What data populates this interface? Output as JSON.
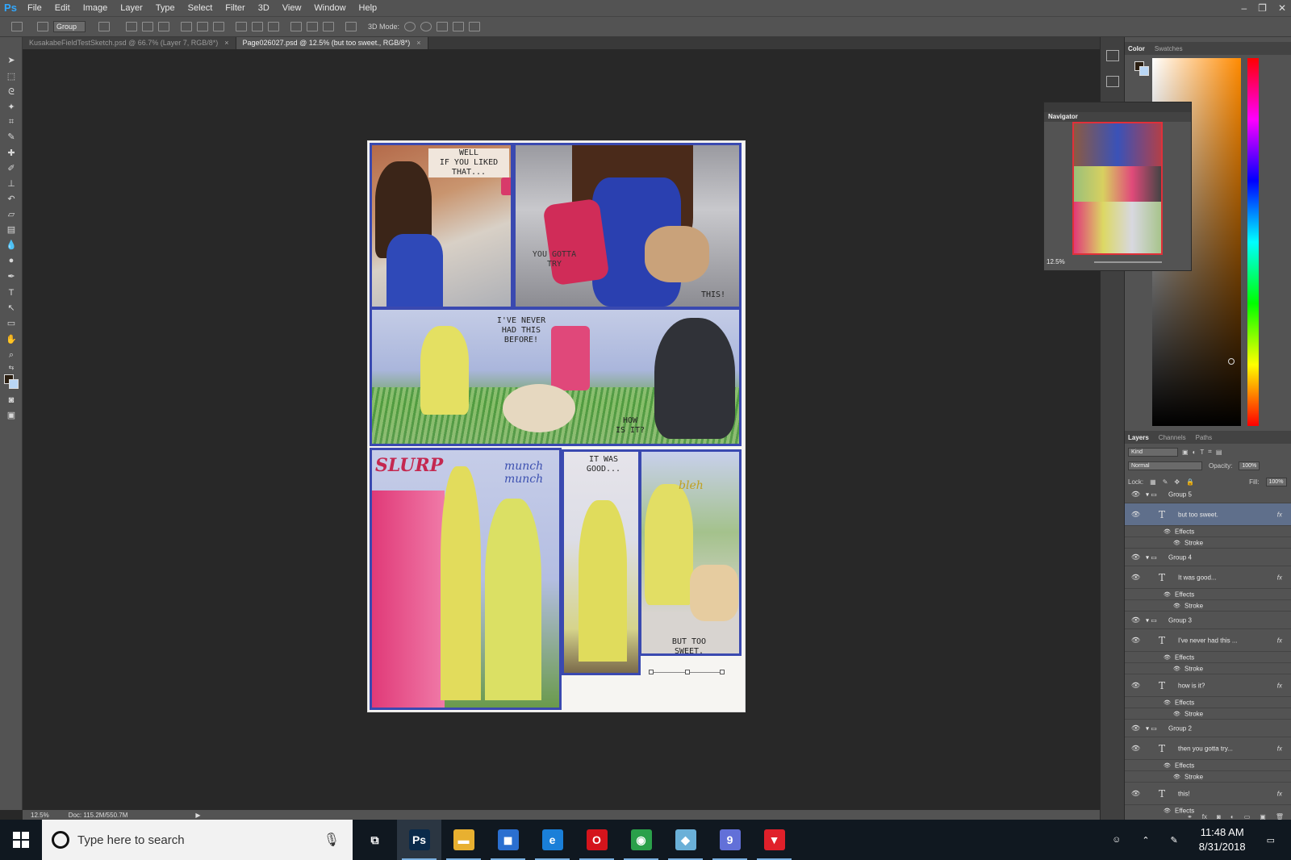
{
  "app": {
    "logo": "Ps"
  },
  "menu": [
    "File",
    "Edit",
    "Image",
    "Layer",
    "Type",
    "Select",
    "Filter",
    "3D",
    "View",
    "Window",
    "Help"
  ],
  "window_controls": {
    "minimize": "–",
    "restore": "❐",
    "close": "✕"
  },
  "options": {
    "group_select": "Group",
    "mode_label": "3D Mode:"
  },
  "tabs": [
    {
      "label": "KusakabeFieldTestSketch.psd @ 66.7% (Layer 7, RGB/8*)",
      "close": "×"
    },
    {
      "label": "Page026027.psd @ 12.5% (but too sweet., RGB/8*)",
      "close": "×"
    }
  ],
  "artwork": {
    "panel1_caption": "WELL\nIF YOU LIKED\nTHAT...",
    "panel2_caption": "YOU GOTTA\nTRY",
    "panel2_caption_b": "THIS!",
    "panel3_caption": "I'VE NEVER\nHAD THIS\nBEFORE!",
    "panel3_caption_b": "HOW\nIS IT?",
    "sfx_slurp": "SLURP",
    "sfx_munch": "munch\nmunch",
    "panel5_caption": "IT WAS\nGOOD...",
    "sfx_bleh": "bleh",
    "panel6_caption": "BUT TOO\nSWEET."
  },
  "statusbar": {
    "zoom": "12.5%",
    "doc": "Doc: 115.2M/550.7M",
    "arrow": "▶"
  },
  "navigator": {
    "title": "Navigator",
    "zoom": "12.5%"
  },
  "color_panel": {
    "tabs": [
      "Color",
      "Swatches"
    ]
  },
  "layers_panel": {
    "tabs": [
      "Layers",
      "Channels",
      "Paths"
    ],
    "kind": "Kind",
    "blend_mode": "Normal",
    "opacity_label": "Opacity:",
    "opacity_value": "100%",
    "lock_label": "Lock:",
    "fill_label": "Fill:",
    "fill_value": "100%",
    "rows": [
      {
        "type": "group",
        "name": "Group 5"
      },
      {
        "type": "text",
        "name": "but too sweet.",
        "fx": "fx",
        "selected": true
      },
      {
        "type": "effects",
        "name": "Effects"
      },
      {
        "type": "stroke",
        "name": "Stroke"
      },
      {
        "type": "group",
        "name": "Group 4"
      },
      {
        "type": "text",
        "name": "It was good...",
        "fx": "fx"
      },
      {
        "type": "effects",
        "name": "Effects"
      },
      {
        "type": "stroke",
        "name": "Stroke"
      },
      {
        "type": "group",
        "name": "Group 3"
      },
      {
        "type": "text",
        "name": "I've never had this ...",
        "fx": "fx"
      },
      {
        "type": "effects",
        "name": "Effects"
      },
      {
        "type": "stroke",
        "name": "Stroke"
      },
      {
        "type": "text",
        "name": "how is it?",
        "fx": "fx"
      },
      {
        "type": "effects",
        "name": "Effects"
      },
      {
        "type": "stroke",
        "name": "Stroke"
      },
      {
        "type": "group",
        "name": "Group 2"
      },
      {
        "type": "text",
        "name": "then you gotta try...",
        "fx": "fx"
      },
      {
        "type": "effects",
        "name": "Effects"
      },
      {
        "type": "stroke",
        "name": "Stroke"
      },
      {
        "type": "text",
        "name": "this!",
        "fx": "fx"
      },
      {
        "type": "effects",
        "name": "Effects"
      }
    ]
  },
  "taskbar": {
    "search_placeholder": "Type here to search",
    "apps": [
      {
        "name": "task-view",
        "glyph": "⧉",
        "color": "#101820"
      },
      {
        "name": "photoshop",
        "glyph": "Ps",
        "color": "#0a2a4a",
        "active": true
      },
      {
        "name": "file-explorer",
        "glyph": "▬",
        "color": "#e8b030"
      },
      {
        "name": "store",
        "glyph": "◼",
        "color": "#2a6fd0"
      },
      {
        "name": "edge",
        "glyph": "e",
        "color": "#1a7fd8"
      },
      {
        "name": "opera",
        "glyph": "O",
        "color": "#d4141c"
      },
      {
        "name": "chrome",
        "glyph": "◉",
        "color": "#2aa04a"
      },
      {
        "name": "paint-tool",
        "glyph": "◆",
        "color": "#6ab0d8"
      },
      {
        "name": "discord",
        "glyph": "9",
        "color": "#6270d8"
      },
      {
        "name": "shield",
        "glyph": "▼",
        "color": "#e0202a"
      }
    ],
    "time": "11:48 AM",
    "date": "8/31/2018"
  }
}
